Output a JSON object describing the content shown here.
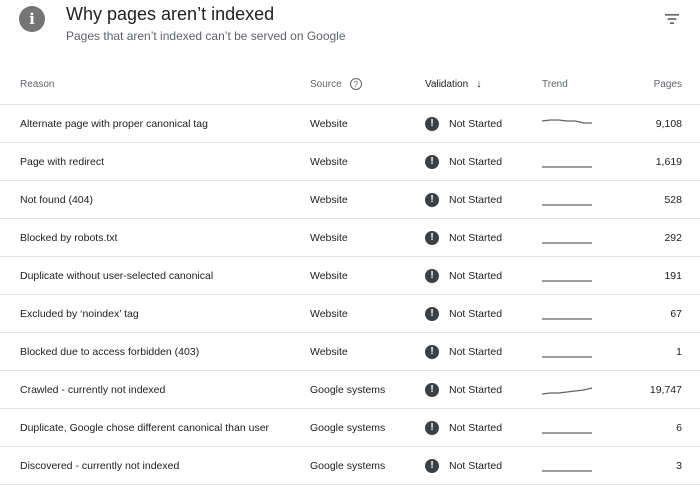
{
  "header": {
    "info_icon": "info-icon",
    "title": "Why pages aren’t indexed",
    "subtitle": "Pages that aren’t indexed can’t be served on Google",
    "filter_icon": "filter-icon"
  },
  "columns": {
    "reason": "Reason",
    "source": "Source",
    "validation": "Validation",
    "trend": "Trend",
    "pages": "Pages"
  },
  "rows": [
    {
      "reason": "Alternate page with proper canonical tag",
      "source": "Website",
      "validation": "Not Started",
      "pages": "9,108",
      "trend": [
        4,
        3,
        3,
        4,
        4,
        6,
        6
      ]
    },
    {
      "reason": "Page with redirect",
      "source": "Website",
      "validation": "Not Started",
      "pages": "1,619",
      "trend": [
        12,
        12,
        12,
        12,
        12,
        12,
        12
      ]
    },
    {
      "reason": "Not found (404)",
      "source": "Website",
      "validation": "Not Started",
      "pages": "528",
      "trend": [
        12,
        12,
        12,
        12,
        12,
        12,
        12
      ]
    },
    {
      "reason": "Blocked by robots.txt",
      "source": "Website",
      "validation": "Not Started",
      "pages": "292",
      "trend": [
        12,
        12,
        12,
        12,
        12,
        12,
        12
      ]
    },
    {
      "reason": "Duplicate without user-selected canonical",
      "source": "Website",
      "validation": "Not Started",
      "pages": "191",
      "trend": [
        12,
        12,
        12,
        12,
        12,
        12,
        12
      ]
    },
    {
      "reason": "Excluded by ‘noindex’ tag",
      "source": "Website",
      "validation": "Not Started",
      "pages": "67",
      "trend": [
        12,
        12,
        12,
        12,
        12,
        12,
        12
      ]
    },
    {
      "reason": "Blocked due to access forbidden (403)",
      "source": "Website",
      "validation": "Not Started",
      "pages": "1",
      "trend": [
        12,
        12,
        12,
        12,
        12,
        12,
        12
      ]
    },
    {
      "reason": "Crawled - currently not indexed",
      "source": "Google systems",
      "validation": "Not Started",
      "pages": "19,747",
      "trend": [
        11,
        10,
        10,
        9,
        8,
        7,
        5
      ]
    },
    {
      "reason": "Duplicate, Google chose different canonical than user",
      "source": "Google systems",
      "validation": "Not Started",
      "pages": "6",
      "trend": [
        12,
        12,
        12,
        12,
        12,
        12,
        12
      ]
    },
    {
      "reason": "Discovered - currently not indexed",
      "source": "Google systems",
      "validation": "Not Started",
      "pages": "3",
      "trend": [
        12,
        12,
        12,
        12,
        12,
        12,
        12
      ]
    }
  ],
  "colors": {
    "info_icon_bg": "#757575",
    "status_icon_bg": "#3c4043",
    "trend_line": "#5f6368",
    "divider": "#e0e0e0"
  }
}
